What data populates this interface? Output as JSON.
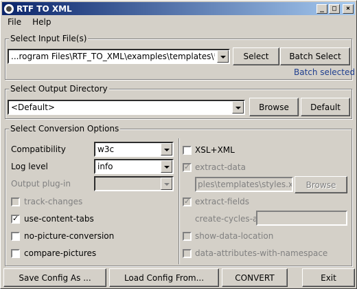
{
  "window": {
    "title": "RTF TO XML"
  },
  "titlebar_buttons": {
    "minimize": "_",
    "maximize": "□",
    "close": "×"
  },
  "menu": [
    "File",
    "Help"
  ],
  "input": {
    "group_title": "Select Input File(s)",
    "path": "...rogram Files\\RTF_TO_XML\\examples\\templates\\*.rtf",
    "select_label": "Select",
    "batch_select_label": "Batch Select",
    "batch_status": "Batch selected"
  },
  "output": {
    "group_title": "Select Output Directory",
    "path": "<Default>",
    "browse_label": "Browse",
    "default_label": "Default"
  },
  "options": {
    "group_title": "Select Conversion Options",
    "compatibility_label": "Compatibility",
    "compatibility_value": "w3c",
    "log_level_label": "Log level",
    "log_level_value": "info",
    "output_plugin_label": "Output plug-in",
    "output_plugin_value": "",
    "track_changes": {
      "label": "track-changes",
      "checked": false,
      "enabled": false
    },
    "use_content_tabs": {
      "label": "use-content-tabs",
      "checked": true,
      "enabled": true
    },
    "no_picture_conversion": {
      "label": "no-picture-conversion",
      "checked": false,
      "enabled": true
    },
    "compare_pictures": {
      "label": "compare-pictures",
      "checked": false,
      "enabled": true
    },
    "xsl_xml": {
      "label": "XSL+XML",
      "checked": false,
      "enabled": true
    },
    "extract_data": {
      "label": "extract-data",
      "checked": true,
      "enabled": false
    },
    "styles_path": "ples\\templates\\styles.xml",
    "styles_browse_label": "Browse",
    "extract_fields": {
      "label": "extract-fields",
      "checked": true,
      "enabled": false
    },
    "create_cycles_at_label": "create-cycles-at",
    "create_cycles_at_value": "",
    "show_data_location": {
      "label": "show-data-location",
      "checked": false,
      "enabled": false
    },
    "data_attributes_with_namespace": {
      "label": "data-attributes-with-namespace",
      "checked": false,
      "enabled": false
    }
  },
  "footer": {
    "save_config_label": "Save Config As ...",
    "load_config_label": "Load Config From...",
    "convert_label": "CONVERT",
    "exit_label": "Exit"
  },
  "check_glyph": "✓"
}
